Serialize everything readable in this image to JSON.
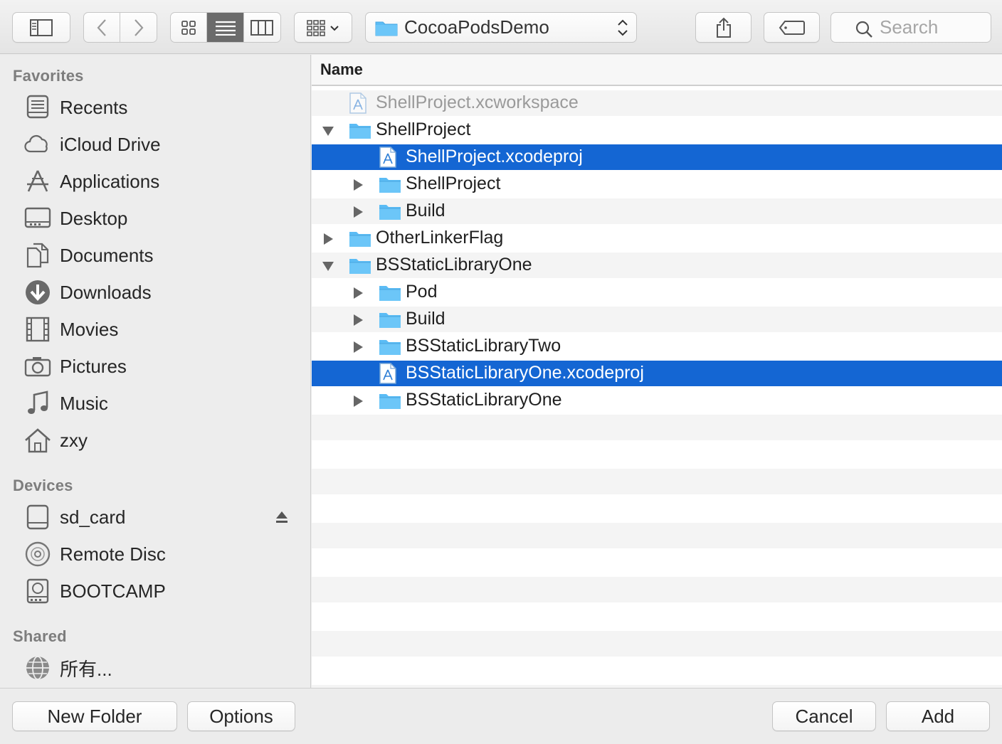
{
  "toolbar": {
    "path_label": "CocoaPodsDemo",
    "search_placeholder": "Search",
    "icons": [
      "sidebar-toggle-icon",
      "back-chevron-icon",
      "forward-chevron-icon",
      "icon-view-icon",
      "list-view-icon",
      "column-view-icon",
      "group-by-icon",
      "folder-icon",
      "share-icon",
      "tag-icon",
      "search-icon"
    ]
  },
  "sidebar": {
    "favorites_heading": "Favorites",
    "favorites": [
      {
        "label": "Recents",
        "icon": "recents-icon"
      },
      {
        "label": "iCloud Drive",
        "icon": "cloud-icon"
      },
      {
        "label": "Applications",
        "icon": "applications-icon"
      },
      {
        "label": "Desktop",
        "icon": "desktop-icon"
      },
      {
        "label": "Documents",
        "icon": "documents-icon"
      },
      {
        "label": "Downloads",
        "icon": "downloads-icon"
      },
      {
        "label": "Movies",
        "icon": "movies-icon"
      },
      {
        "label": "Pictures",
        "icon": "camera-icon"
      },
      {
        "label": "Music",
        "icon": "music-note-icon"
      },
      {
        "label": "zxy",
        "icon": "home-icon"
      }
    ],
    "devices_heading": "Devices",
    "devices": [
      {
        "label": "sd_card",
        "icon": "drive-icon"
      },
      {
        "label": "Remote Disc",
        "icon": "disc-icon"
      },
      {
        "label": "BOOTCAMP",
        "icon": "hard-disk-icon"
      }
    ],
    "shared_heading": "Shared",
    "shared": [
      {
        "label": "所有...",
        "icon": "network-globe-icon"
      }
    ]
  },
  "list": {
    "column_header": "Name",
    "rows": [
      {
        "name": "ShellProject.xcworkspace",
        "kind": "file",
        "depth": 0,
        "disclosure": "none",
        "selected": false,
        "dimmed": true
      },
      {
        "name": "ShellProject",
        "kind": "folder",
        "depth": 0,
        "disclosure": "open",
        "selected": false,
        "dimmed": false
      },
      {
        "name": "ShellProject.xcodeproj",
        "kind": "file",
        "depth": 1,
        "disclosure": "none",
        "selected": true,
        "dimmed": false
      },
      {
        "name": "ShellProject",
        "kind": "folder",
        "depth": 1,
        "disclosure": "closed",
        "selected": false,
        "dimmed": false
      },
      {
        "name": "Build",
        "kind": "folder",
        "depth": 1,
        "disclosure": "closed",
        "selected": false,
        "dimmed": false
      },
      {
        "name": "OtherLinkerFlag",
        "kind": "folder",
        "depth": 0,
        "disclosure": "closed",
        "selected": false,
        "dimmed": false
      },
      {
        "name": "BSStaticLibraryOne",
        "kind": "folder",
        "depth": 0,
        "disclosure": "open",
        "selected": false,
        "dimmed": false
      },
      {
        "name": "Pod",
        "kind": "folder",
        "depth": 1,
        "disclosure": "closed",
        "selected": false,
        "dimmed": false
      },
      {
        "name": "Build",
        "kind": "folder",
        "depth": 1,
        "disclosure": "closed",
        "selected": false,
        "dimmed": false
      },
      {
        "name": "BSStaticLibraryTwo",
        "kind": "folder",
        "depth": 1,
        "disclosure": "closed",
        "selected": false,
        "dimmed": false
      },
      {
        "name": "BSStaticLibraryOne.xcodeproj",
        "kind": "file",
        "depth": 1,
        "disclosure": "none",
        "selected": true,
        "dimmed": false
      },
      {
        "name": "BSStaticLibraryOne",
        "kind": "folder",
        "depth": 1,
        "disclosure": "closed",
        "selected": false,
        "dimmed": false
      }
    ]
  },
  "buttons": {
    "new_folder": "New Folder",
    "options": "Options",
    "cancel": "Cancel",
    "add": "Add"
  },
  "colors": {
    "selection": "#1466d3",
    "folder": "#5bbcf5"
  }
}
